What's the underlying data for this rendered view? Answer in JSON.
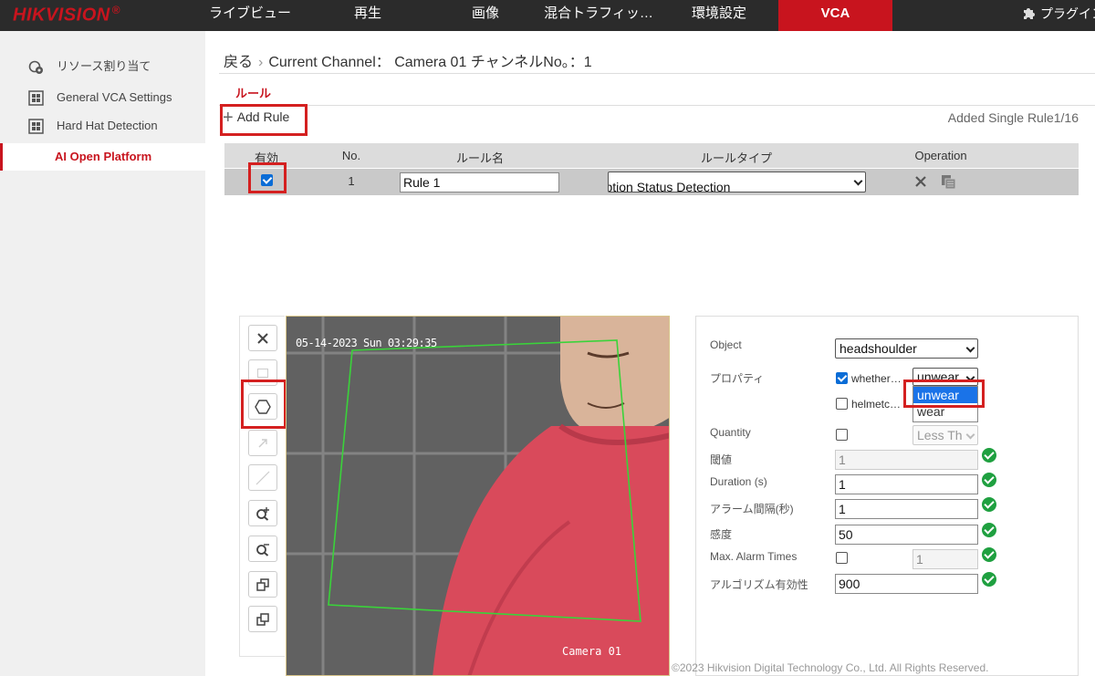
{
  "brand": {
    "logo": "HIKVISION",
    "reg": "®",
    "accent": "#c8141e"
  },
  "nav": {
    "items": [
      "ライブビュー",
      "再生",
      "画像",
      "混合トラフィッ…",
      "環境設定",
      "VCA"
    ],
    "active": "VCA",
    "plugin": "プラグイン"
  },
  "sidebar": {
    "items": [
      "リソース割り当て",
      "General VCA Settings",
      "Hard Hat Detection",
      "AI Open Platform"
    ],
    "active": "AI Open Platform"
  },
  "breadcrumb": {
    "back": "戻る",
    "channel": "Current Channel： Camera 01 チャンネルNo。：1"
  },
  "rules": {
    "section_title": "ルール",
    "add_label": "Add Rule",
    "count_label": "Added Single Rule1/16",
    "columns": [
      "有効",
      "No.",
      "ルール名",
      "ルールタイプ",
      "Operation"
    ],
    "rows": [
      {
        "enabled": true,
        "no": "1",
        "name": "Rule 1",
        "type": "Region Target Exception Status Detection"
      }
    ]
  },
  "video": {
    "timestamp": "05-14-2023 Sun 03:29:35",
    "camera_name": "Camera 01"
  },
  "props": {
    "object_label": "Object",
    "object_value": "headshoulder",
    "property_label": "プロパティ",
    "prop1_label": "whether…",
    "prop1_checked": true,
    "prop1_value": "unwear",
    "prop2_label": "helmetc…",
    "prop2_checked": false,
    "dropdown_options": [
      "unwear",
      "wear"
    ],
    "dropdown_selected": "unwear",
    "quantity_label": "Quantity",
    "quantity_select": "Less Th",
    "threshold_label": "閾値",
    "threshold_value": "1",
    "duration_label": "Duration (s)",
    "duration_value": "1",
    "alarm_interval_label": "アラーム間隔(秒)",
    "alarm_interval_value": "1",
    "sensitivity_label": "感度",
    "sensitivity_value": "50",
    "max_alarm_label": "Max. Alarm Times",
    "max_alarm_value": "1",
    "algo_label": "アルゴリズム有効性",
    "algo_value": "900"
  },
  "footer": "©2023 Hikvision Digital Technology Co., Ltd. All Rights Reserved."
}
